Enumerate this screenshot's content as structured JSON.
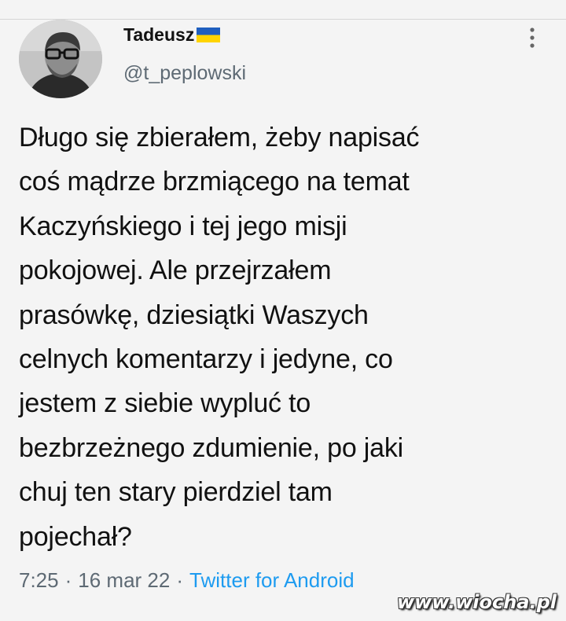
{
  "tweet": {
    "author_name": "Tadeusz",
    "author_flag": "ukraine-flag-icon",
    "handle": "@t_peplowski",
    "text": "Długo się zbierałem, żeby napisać\ncoś mądrze brzmiącego na temat\nKaczyńskiego i tej jego misji\npokojowej.  Ale przejrzałem\nprasówkę, dziesiątki Waszych\ncelnych komentarzy i jedyne, co\njestem z siebie wypluć to\nbezbrzeżnego zdumienie, po jaki\nchuj ten stary pierdziel tam\npojechał?",
    "time": "7:25",
    "date": "16 mar 22",
    "source": "Twitter for Android",
    "separator": "·"
  },
  "watermark": "www.wiocha.pl",
  "colors": {
    "background": "#f4f4f4",
    "text": "#111111",
    "muted": "#5e6a74",
    "link": "#1d9bf0",
    "flag_blue": "#1f5fbf",
    "flag_yellow": "#ffd400"
  }
}
